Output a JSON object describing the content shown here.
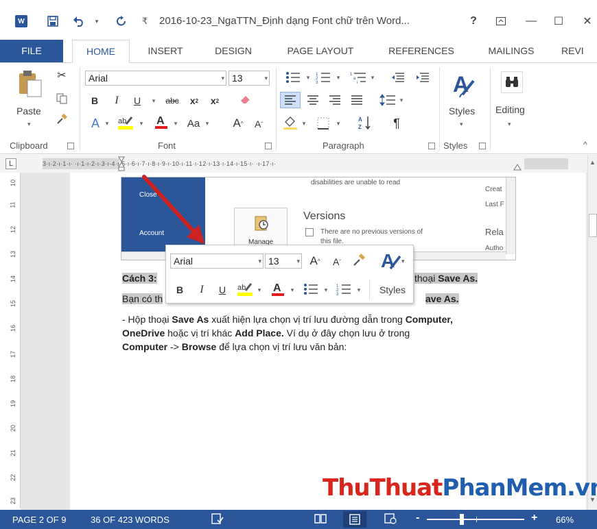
{
  "titlebar": {
    "app_icon": "W",
    "title": "2016-10-23_NgaTTN_Định dạng Font chữ trên Word...",
    "help": "?",
    "ribbon_options_icon": "ribbon-display-options-icon",
    "minimize": "—",
    "maximize": "☐",
    "close": "✕"
  },
  "tabs": [
    "FILE",
    "HOME",
    "INSERT",
    "DESIGN",
    "PAGE LAYOUT",
    "REFERENCES",
    "MAILINGS",
    "REVI"
  ],
  "ribbon": {
    "clipboard": {
      "paste_label": "Paste",
      "group_label": "Clipboard"
    },
    "font": {
      "name": "Arial",
      "size": "13",
      "group_label": "Font"
    },
    "paragraph": {
      "group_label": "Paragraph"
    },
    "styles": {
      "label": "Styles",
      "group_label": "Styles"
    },
    "editing": {
      "label": "Editing"
    }
  },
  "ruler": {
    "corner": "L",
    "marks": "3·ı·2·ı·1·ı·  ·ı·1·ı·2·ı·3·ı·4·ı·5·ı·6·ı·7·ı·8·ı·9·ı·10·ı·11·ı·12·ı·13·ı·14·ı·15·ı·  ·ı·17·ı·",
    "vertical": [
      "10",
      "11",
      "12",
      "13",
      "14",
      "15",
      "16",
      "17",
      "18",
      "19",
      "20",
      "21",
      "22",
      "23"
    ]
  },
  "embedded": {
    "close": "Close",
    "account": "Account",
    "disabilities": "disabilities are unable to read",
    "versions_title": "Versions",
    "manage": "Manage",
    "no_versions": "There are no previous versions of",
    "this_file": "this file.",
    "created": "Creat",
    "last": "Last F",
    "related": "Rela",
    "author": "Autho"
  },
  "document": {
    "line1_a": "Cách 3:",
    "line1_b": "thoại",
    "line1_c": "Save As.",
    "line2_a": "Bạn có th",
    "line2_b": "ave As.",
    "line3_a": "- Hộp thoại ",
    "line3_b": "Save As",
    "line3_c": " xuất hiện lựa chọn vị trí lưu đường dẫn trong ",
    "line3_d": "Computer,",
    "line4_a": "OneDrive",
    "line4_b": " hoặc vị trí khác ",
    "line4_c": "Add Place.",
    "line4_d": " Ví dụ ở đây chọn lưu ở trong",
    "line5_a": "Computer",
    "line5_b": " -> ",
    "line5_c": "Browse",
    "line5_d": " để lựa chọn vị trí lưu văn bản:"
  },
  "mini_toolbar": {
    "font": "Arial",
    "size": "13",
    "bold": "B",
    "italic": "I",
    "underline": "U",
    "styles": "Styles"
  },
  "watermark": {
    "part1": "ThuThuat",
    "part2": "PhanMem",
    "part3": ".vn"
  },
  "statusbar": {
    "page": "PAGE 2 OF 9",
    "words": "36 OF 423 WORDS",
    "zoom_minus": "-",
    "zoom_plus": "+",
    "zoom": "66%"
  },
  "colors": {
    "accent": "#2b579a",
    "highlight_text": "#c8c8c8",
    "watermark_red": "#d9261c",
    "watermark_blue": "#1f5fae",
    "arrow_red": "#cc2222"
  }
}
